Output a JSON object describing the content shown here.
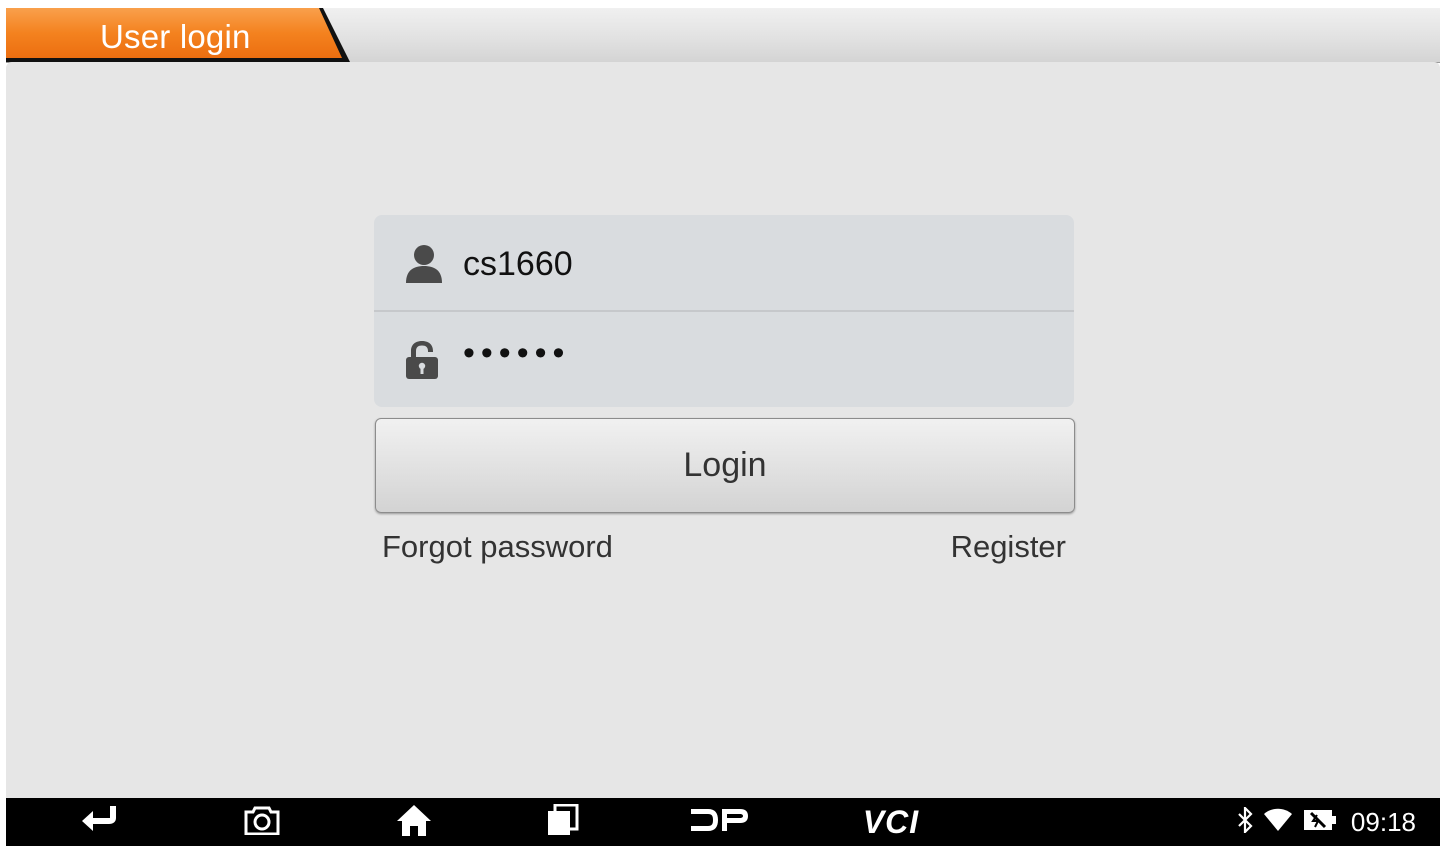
{
  "title": "User login",
  "login_form": {
    "username_value": "cs1660",
    "password_value": "••••••",
    "login_label": "Login",
    "forgot_password_label": "Forgot password",
    "register_label": "Register"
  },
  "nav_bar": {
    "buttons": [
      {
        "icon": "back-icon"
      },
      {
        "icon": "camera-icon"
      },
      {
        "icon": "home-icon"
      },
      {
        "icon": "recent-apps-icon"
      },
      {
        "icon": "dp-logo-icon"
      },
      {
        "icon": "vci-icon",
        "label": "VCI"
      }
    ],
    "status": {
      "icons": [
        "bluetooth-icon",
        "wifi-icon",
        "battery-icon"
      ],
      "time": "09:18"
    }
  },
  "colors": {
    "accent": "#f07e24",
    "background": "#e6e6e6",
    "field": "#d9dcdf",
    "nav_bar": "#000000"
  }
}
